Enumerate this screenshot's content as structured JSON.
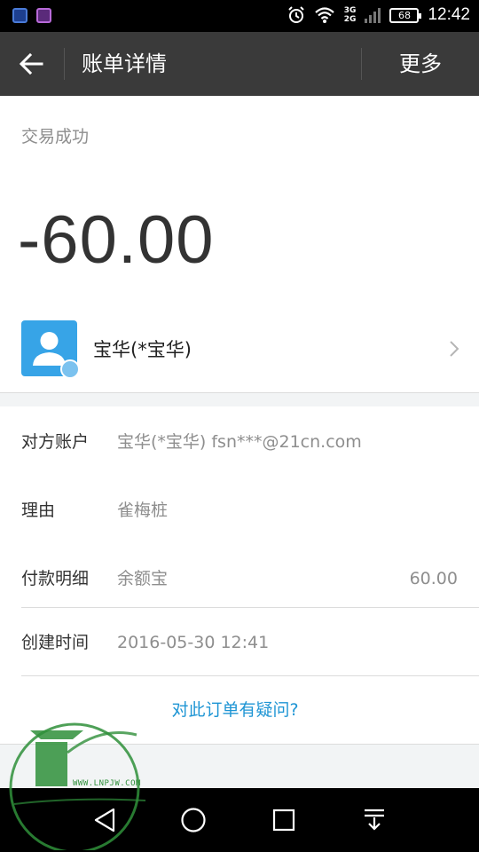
{
  "status_bar": {
    "network_top": "3G",
    "network_bottom": "2G",
    "battery": "68",
    "time": "12:42",
    "icons": [
      "shield-icon",
      "gallery-icon",
      "alarm-icon",
      "wifi-icon",
      "signal-icon",
      "battery-icon"
    ]
  },
  "header": {
    "title": "账单详情",
    "more_label": "更多"
  },
  "transaction": {
    "status": "交易成功",
    "amount": "-60.00"
  },
  "counterparty": {
    "name": "宝华(*宝华)"
  },
  "details": [
    {
      "label": "对方账户",
      "value": "宝华(*宝华) fsn***@21cn.com"
    },
    {
      "label": "理由",
      "value": "雀梅桩"
    },
    {
      "label": "付款明细",
      "value": "余额宝",
      "amount": "60.00"
    },
    {
      "label": "创建时间",
      "value": "2016-05-30 12:41"
    }
  ],
  "question_link": "对此订单有疑问?",
  "watermark": {
    "url": "WWW.LNPJW.COM"
  },
  "colors": {
    "title_bar": "#3a3a3a",
    "accent_link": "#1e95d4",
    "avatar_bg": "#37a4e7",
    "amount_text": "#333333"
  }
}
